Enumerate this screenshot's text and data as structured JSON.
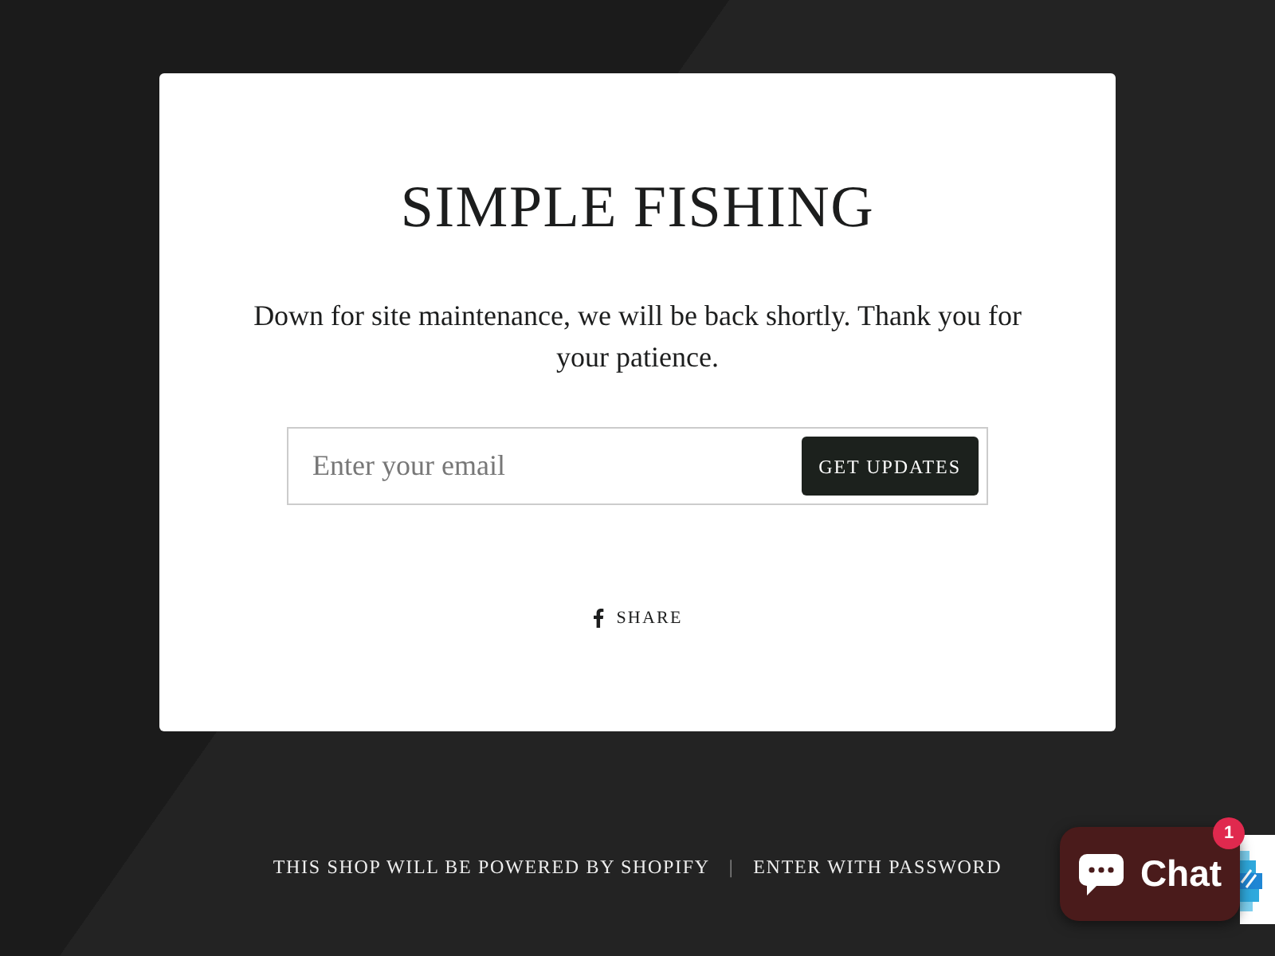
{
  "card": {
    "title": "SIMPLE FISHING",
    "message": "Down for site maintenance, we will be back shortly. Thank you for your patience."
  },
  "signup": {
    "placeholder": "Enter your email",
    "button": "GET UPDATES"
  },
  "share": {
    "label": "SHARE"
  },
  "footer": {
    "items": [
      {
        "kind": "text",
        "label": "THIS SHOP WILL BE POWERED BY SHOPIFY"
      },
      {
        "kind": "separator",
        "label": "|"
      },
      {
        "kind": "link",
        "label": "ENTER WITH PASSWORD"
      }
    ]
  },
  "chat": {
    "label": "Chat",
    "badge": "1"
  }
}
